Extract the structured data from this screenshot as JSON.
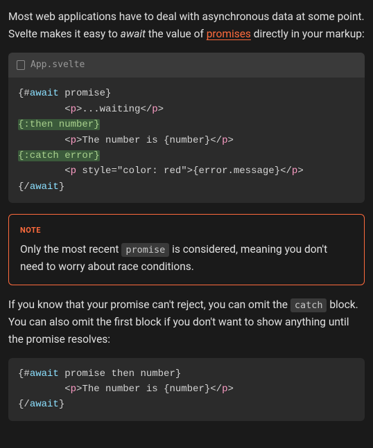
{
  "p1": {
    "part1": "Most web applications have to deal with asynchronous data at some point. Svelte makes it easy to ",
    "await_word": "await",
    "part2": " the value of ",
    "link": "promises",
    "part3": " directly in your markup:"
  },
  "code1": {
    "filename": "App.svelte",
    "l1_open": "{#",
    "l1_await": "await",
    "l1_rest": " promise}",
    "l2_pre": "\t<",
    "l2_tag": "p",
    "l2_mid": ">...waiting</",
    "l2_tag2": "p",
    "l2_end": ">",
    "l3": "{:then number}",
    "l4_pre": "\t<",
    "l4_tag": "p",
    "l4_mid": ">The number is {number}</",
    "l4_tag2": "p",
    "l4_end": ">",
    "l5": "{:catch error}",
    "l6_pre": "\t<",
    "l6_tag": "p",
    "l6_attr": " style=\"color: red\"",
    "l6_mid": ">{error.message}</",
    "l6_tag2": "p",
    "l6_end": ">",
    "l7_open": "{/",
    "l7_await": "await",
    "l7_close": "}"
  },
  "note": {
    "label": "NOTE",
    "part1": "Only the most recent ",
    "code": "promise",
    "part2": " is considered, meaning you don't need to worry about race conditions."
  },
  "p2": {
    "part1": "If you know that your promise can't reject, you can omit the ",
    "code": "catch",
    "part2": " block. You can also omit the first block if you don't want to show anything until the promise resolves:"
  },
  "code2": {
    "l1_open": "{#",
    "l1_await": "await",
    "l1_rest": " promise then number}",
    "l2_pre": "\t<",
    "l2_tag": "p",
    "l2_mid": ">The number is {number}</",
    "l2_tag2": "p",
    "l2_end": ">",
    "l3_open": "{/",
    "l3_await": "await",
    "l3_close": "}"
  }
}
